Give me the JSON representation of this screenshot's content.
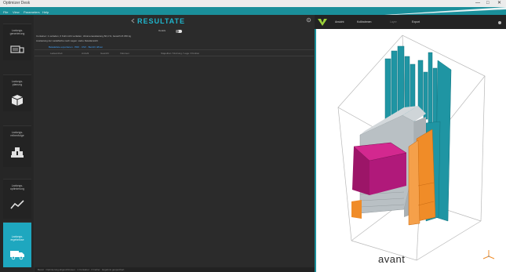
{
  "window": {
    "title": "Optimizer Desk",
    "controls": [
      "—",
      "□",
      "✕"
    ]
  },
  "menu": {
    "items": [
      "File",
      "View",
      "Parameters",
      "Help"
    ]
  },
  "sidebar": {
    "items": [
      {
        "label": "Ladungs-\ngenerierung",
        "icon": "truck-loader-icon"
      },
      {
        "label": "Ladungs-\nplanung",
        "icon": "package-box-icon"
      },
      {
        "label": "Ladungs-\nreihenfolge",
        "icon": "stacked-boxes-icon"
      },
      {
        "label": "Ladungs-\noptimierung",
        "icon": "line-chart-icon"
      },
      {
        "label": "Ladungs-\nergebnisse",
        "icon": "delivery-truck-icon",
        "active": true
      }
    ]
  },
  "main": {
    "title": "RESULTATE",
    "toggle_label": "Details",
    "info_line_1": "Container: 1 verladen, 0 Kolli nicht verladen, Volumenauslastung 82,4 %, Gewicht 8.450 kg",
    "info_line_2": "Auslastung der Ladefläche nach Lagen: siehe Detailansicht",
    "link_text": "Beladeliste exportieren · PDF · CSV · Bericht öffnen",
    "table_headers": [
      "Ladeeinheit",
      "Anzahl",
      "Gewicht",
      "Volumen",
      "Stapelbar / Drehung / Lage / Position"
    ],
    "status_text": "Bereit · Optimierung abgeschlossen · 1 Container · 0 Fehler · Ergebnis gespeichert"
  },
  "viewer": {
    "tools": [
      "Ansicht",
      "Kollirahmen",
      "Layer",
      "Export"
    ],
    "brand": "avant",
    "colors": {
      "teal": "#1f95a3",
      "grey": "#b9c0c4",
      "magenta": "#b0197a",
      "orange": "#f08c28"
    }
  }
}
